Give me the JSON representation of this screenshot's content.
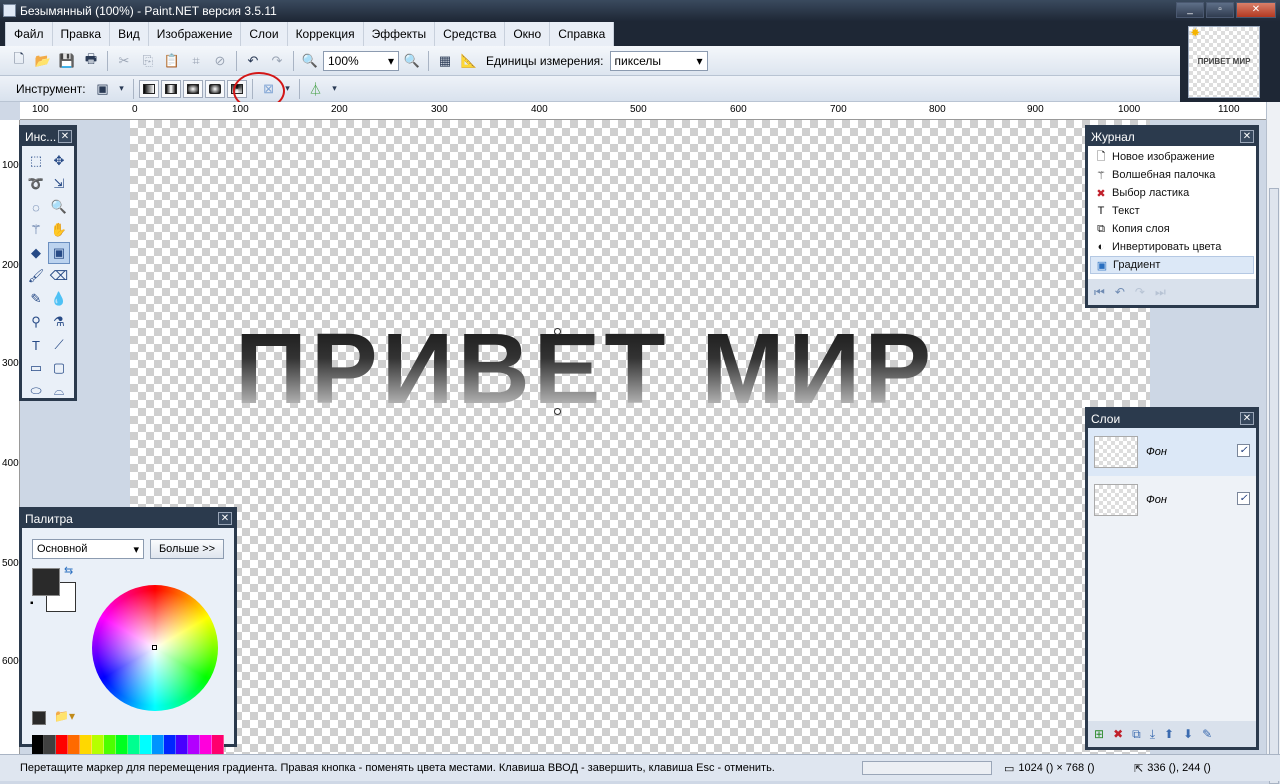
{
  "window": {
    "title": "Безымянный (100%) - Paint.NET версия 3.5.11",
    "thumbnail_text": "ПРИВЕТ МИР"
  },
  "menu": [
    "Файл",
    "Правка",
    "Вид",
    "Изображение",
    "Слои",
    "Коррекция",
    "Эффекты",
    "Средства",
    "Окно",
    "Справка"
  ],
  "toolbar": {
    "zoom_value": "100%",
    "units_label": "Единицы измерения:",
    "units_value": "пикселы",
    "tool_label": "Инструмент:"
  },
  "ruler": {
    "h_ticks": [
      "100",
      "0",
      "100",
      "200",
      "300",
      "400",
      "500",
      "600",
      "700",
      "800",
      "900",
      "1000",
      "1100"
    ],
    "v_ticks": [
      "100",
      "200",
      "300",
      "400",
      "500",
      "600"
    ]
  },
  "canvas": {
    "text": "ПРИВЕТ МИР"
  },
  "tools_panel": {
    "title": "Инс..."
  },
  "history_panel": {
    "title": "Журнал",
    "items": [
      {
        "label": "Новое изображение",
        "icon": "new-image-icon"
      },
      {
        "label": "Волшебная палочка",
        "icon": "magic-wand-icon"
      },
      {
        "label": "Выбор ластика",
        "icon": "eraser-selection-icon"
      },
      {
        "label": "Текст",
        "icon": "text-icon"
      },
      {
        "label": "Копия слоя",
        "icon": "duplicate-layer-icon"
      },
      {
        "label": "Инвертировать цвета",
        "icon": "invert-colors-icon"
      },
      {
        "label": "Градиент",
        "icon": "gradient-icon"
      }
    ]
  },
  "layers_panel": {
    "title": "Слои",
    "layers": [
      {
        "name": "Фон",
        "visible": true
      },
      {
        "name": "Фон",
        "visible": true
      }
    ]
  },
  "palette_panel": {
    "title": "Палитра",
    "mode": "Основной",
    "more_button": "Больше >>",
    "swatches": [
      "#000000",
      "#404040",
      "#ff0000",
      "#ff6a00",
      "#ffd800",
      "#b6ff00",
      "#4cff00",
      "#00ff21",
      "#00ff90",
      "#00ffff",
      "#0094ff",
      "#0026ff",
      "#4800ff",
      "#b200ff",
      "#ff00dc",
      "#ff006e"
    ]
  },
  "status": {
    "message": "Перетащите маркер для перемещения градиента. Правая кнопка - поменять цвета местами. Клавиша ВВОД - завершить, клавиша Esc - отменить.",
    "image_size": "1024 () × 768 ()",
    "cursor_pos": "336 (), 244 ()"
  }
}
